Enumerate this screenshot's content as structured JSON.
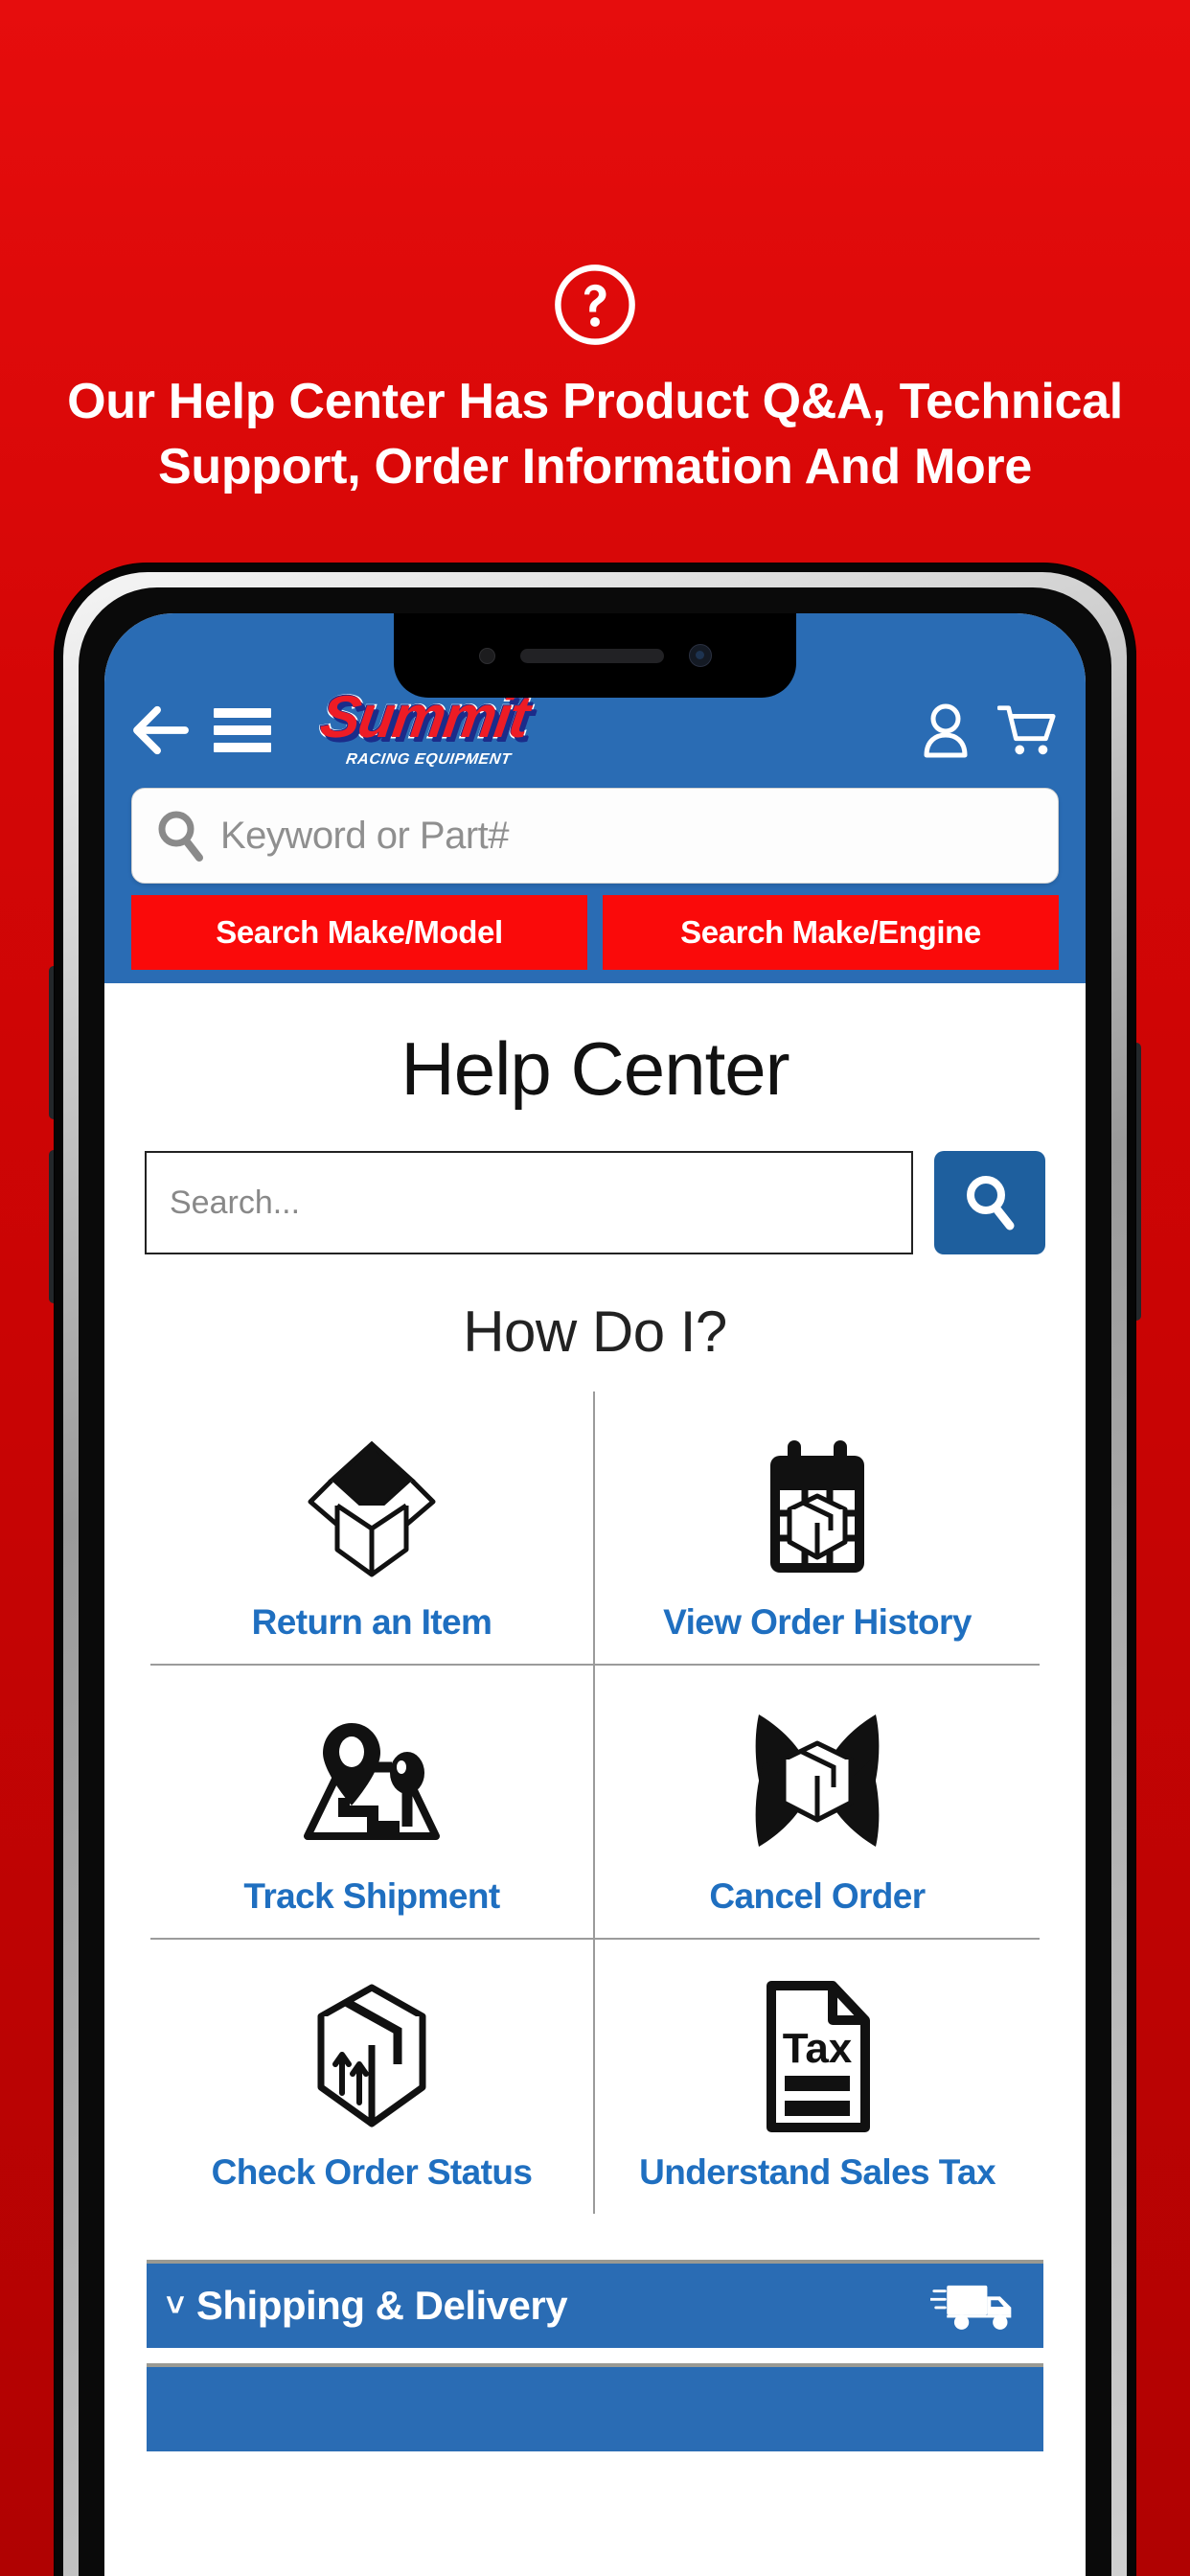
{
  "promo": {
    "icon": "question-circle-icon",
    "headline": "Our Help Center Has Product Q&A, Technical Support, Order Information And More"
  },
  "colors": {
    "background_red_top": "#e60d0d",
    "background_red_bottom": "#b00202",
    "header_blue": "#2a6cb4",
    "button_red": "#fa0a0a",
    "link_blue": "#1f6fc0",
    "search_button_blue": "#1e5f9e",
    "logo_red": "#ee1c25",
    "logo_navy": "#1b2c8a",
    "divider_gray": "#9b9b9b"
  },
  "app_header": {
    "back_icon": "arrow-left-icon",
    "menu_icon": "hamburger-menu-icon",
    "logo": {
      "word": "Summit",
      "tagline": "RACING EQUIPMENT",
      "registered": "®"
    },
    "account_icon": "user-account-icon",
    "cart_icon": "shopping-cart-icon"
  },
  "site_search": {
    "icon": "search-icon",
    "placeholder": "Keyword or Part#",
    "value": "",
    "buttons": [
      {
        "label": "Search Make/Model"
      },
      {
        "label": "Search Make/Engine"
      }
    ]
  },
  "help_center": {
    "title": "Help Center",
    "search": {
      "placeholder": "Search...",
      "value": "",
      "button_icon": "search-icon"
    },
    "how_do_i": {
      "heading": "How Do I?",
      "items": [
        {
          "label": "Return an Item",
          "icon": "open-box-icon"
        },
        {
          "label": "View Order History",
          "icon": "calendar-package-icon"
        },
        {
          "label": "Track Shipment",
          "icon": "map-pin-route-icon"
        },
        {
          "label": "Cancel Order",
          "icon": "package-x-cancel-icon"
        },
        {
          "label": "Check Order Status",
          "icon": "package-up-arrows-icon"
        },
        {
          "label": "Understand Sales Tax",
          "icon": "tax-document-icon"
        }
      ]
    },
    "accordions": [
      {
        "label": "Shipping & Delivery",
        "chevron": "˅",
        "icon": "delivery-truck-icon"
      },
      {
        "label": "",
        "chevron": "",
        "icon": ""
      }
    ]
  }
}
